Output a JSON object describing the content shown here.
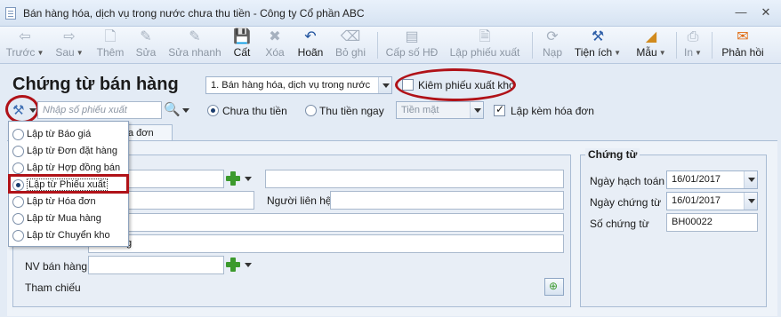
{
  "window": {
    "title": "Bán hàng hóa, dịch vụ trong nước chưa thu tiền - Công ty Cổ phần ABC",
    "minimize": "—",
    "close": "✕"
  },
  "toolbar": [
    {
      "label": "Trước",
      "icon": "arrow-left-icon",
      "glyph": "⇦",
      "enabled": false,
      "dropdown": true
    },
    {
      "label": "Sau",
      "icon": "arrow-right-icon",
      "glyph": "⇨",
      "enabled": false,
      "dropdown": true
    },
    {
      "label": "Thêm",
      "icon": "new-document-icon",
      "glyph": "🗋",
      "enabled": false
    },
    {
      "label": "Sửa",
      "icon": "edit-icon",
      "glyph": "✎",
      "enabled": false
    },
    {
      "label": "Sửa nhanh",
      "icon": "quick-edit-icon",
      "glyph": "✎",
      "enabled": false
    },
    {
      "label": "Cất",
      "icon": "save-icon",
      "glyph": "💾",
      "enabled": true
    },
    {
      "label": "Xóa",
      "icon": "delete-icon",
      "glyph": "✖",
      "enabled": false
    },
    {
      "label": "Hoãn",
      "icon": "undo-icon",
      "glyph": "↶",
      "enabled": true
    },
    {
      "label": "Bỏ ghi",
      "icon": "unpost-icon",
      "glyph": "⌫",
      "enabled": false
    },
    {
      "label": "Cấp số HĐ",
      "icon": "invoice-number-icon",
      "glyph": "▤",
      "enabled": false
    },
    {
      "label": "Lập phiếu xuất",
      "icon": "issue-slip-icon",
      "glyph": "🗎",
      "enabled": false
    },
    {
      "label": "Nạp",
      "icon": "reload-icon",
      "glyph": "⟳",
      "enabled": false
    },
    {
      "label": "Tiện ích",
      "icon": "utilities-icon",
      "glyph": "⚒",
      "enabled": true,
      "dropdown": true
    },
    {
      "label": "Mẫu",
      "icon": "template-icon",
      "glyph": "◢",
      "enabled": true,
      "dropdown": true
    },
    {
      "label": "In",
      "icon": "print-icon",
      "glyph": "⎙",
      "enabled": false,
      "dropdown": true
    },
    {
      "label": "Phản hồi",
      "icon": "feedback-mail-icon",
      "glyph": "✉",
      "enabled": true
    }
  ],
  "form": {
    "title": "Chứng từ bán hàng",
    "transaction_type": "1. Bán hàng hóa, dịch vụ trong nước",
    "kiem_phieu_xuat_kho": "Kiêm phiếu xuất kho",
    "search_placeholder": "Nhập số phiếu xuất",
    "payment_unpaid": "Chưa thu tiền",
    "payment_paid": "Thu tiền ngay",
    "payment_method": "Tiền mặt",
    "with_invoice": "Lập kèm hóa đơn",
    "tab_invoice_partial": "a đơn"
  },
  "create_from_menu": {
    "selected": "Lập từ Phiếu xuất",
    "items": [
      "Lập từ Báo giá",
      "Lập từ Đơn đặt hàng",
      "Lập từ Hợp đồng bán",
      "Lập từ Phiếu xuất",
      "Lập từ Hóa đơn",
      "Lập từ Mua hàng",
      "Lập từ Chuyển kho"
    ]
  },
  "customer": {
    "contact_label": "Người liên hệ",
    "description_partial": "g",
    "salesperson_label": "NV bán hàng",
    "reference_label": "Tham chiếu"
  },
  "voucher": {
    "title": "Chứng từ",
    "posting_date_label": "Ngày hạch toán",
    "posting_date": "16/01/2017",
    "voucher_date_label": "Ngày chứng từ",
    "voucher_date": "16/01/2017",
    "voucher_no_label": "Số chứng từ",
    "voucher_no": "BH00022"
  },
  "colors": {
    "highlight": "#b01218",
    "accent_green": "#3c9a2d"
  }
}
